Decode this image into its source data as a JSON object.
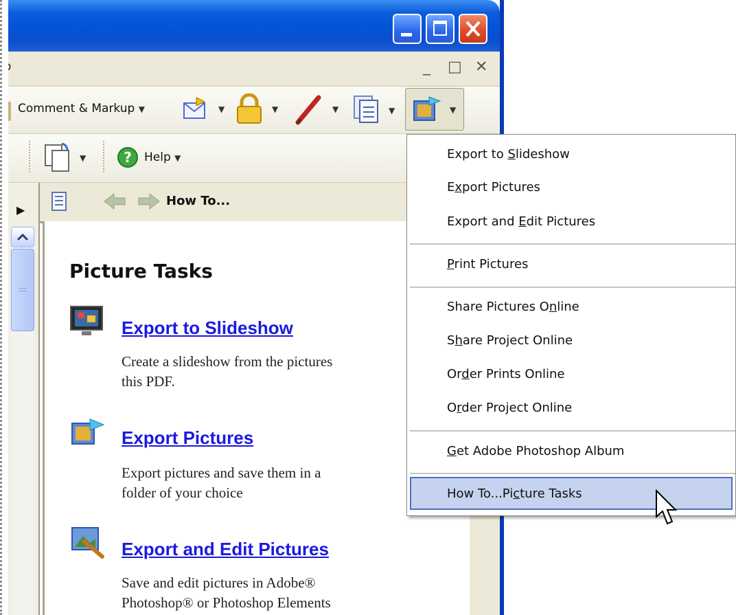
{
  "window": {
    "menubar_fragment": "o",
    "mdi_buttons": {
      "minimize": "_",
      "restore": "□",
      "close": "✕"
    }
  },
  "toolbar": {
    "comment_markup_label": "Comment & Markup",
    "help_label": "Help"
  },
  "navigation": {
    "howto_label": "How To..."
  },
  "content": {
    "title": "Picture Tasks",
    "tasks": [
      {
        "link": "Export to Slideshow",
        "desc_line1": "Create a slideshow from the pictures",
        "desc_line2": "this PDF."
      },
      {
        "link": "Export Pictures",
        "desc_line1": "Export pictures and save them in a",
        "desc_line2": "folder of your choice"
      },
      {
        "link": "Export and Edit Pictures",
        "desc_line1": "Save and edit pictures in Adobe®",
        "desc_line2": "Photoshop® or Photoshop Elements"
      }
    ]
  },
  "popup_menu": {
    "items": [
      {
        "pre": "Export to ",
        "key": "S",
        "post": "lideshow"
      },
      {
        "pre": "E",
        "key": "x",
        "post": "port Pictures"
      },
      {
        "pre": "Export and ",
        "key": "E",
        "post": "dit Pictures"
      },
      {
        "pre": "",
        "key": "P",
        "post": "rint Pictures"
      },
      {
        "pre": "Share Pictures O",
        "key": "n",
        "post": "line"
      },
      {
        "pre": "S",
        "key": "h",
        "post": "are Project Online"
      },
      {
        "pre": "Or",
        "key": "d",
        "post": "er Prints Online"
      },
      {
        "pre": "O",
        "key": "r",
        "post": "der Project Online"
      },
      {
        "pre": "",
        "key": "G",
        "post": "et Adobe Photoshop Album"
      },
      {
        "pre": "How To...Pi",
        "key": "c",
        "post": "ture Tasks"
      }
    ]
  },
  "colors": {
    "titlebar_blue": "#0553d6",
    "link_blue": "#1a1ae0",
    "menu_highlight": "#c6d3ef",
    "toolbar_beige": "#ece9d8"
  }
}
